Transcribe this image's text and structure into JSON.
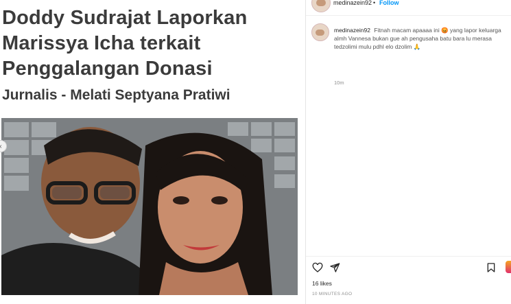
{
  "media": {
    "headline": "Doddy Sudrajat Laporkan Marissya Icha terkait Penggalangan Donasi",
    "byline": "Jurnalis - Melati Septyana Pratiwi"
  },
  "header": {
    "username": "medinazein92",
    "separator": "•",
    "follow_label": "Follow"
  },
  "comment": {
    "username": "medinazein92",
    "text": "Fitnah macam apaaaa ini 😡 yang lapor keluarga almh Vannesa bukan gue ah pengusaha batu bara lu merasa tedzolimi mulu pdhl elo dzolim 🙏",
    "time": "10m"
  },
  "footer": {
    "likes": "16 likes",
    "timestamp": "10 MINUTES AGO"
  },
  "icons": {
    "like": "heart-icon",
    "share": "share-icon",
    "save": "bookmark-icon"
  }
}
